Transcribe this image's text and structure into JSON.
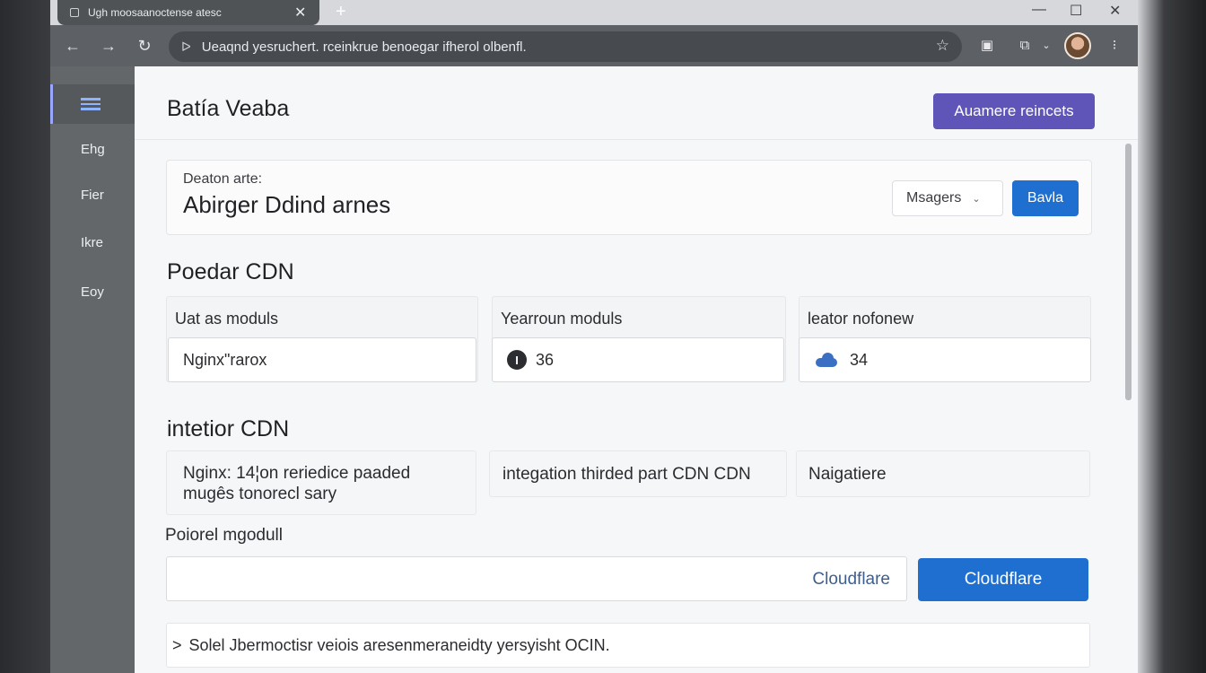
{
  "browser": {
    "tab_title": "Ugh moosaanoctense atesc",
    "tab_close": "✕",
    "new_tab": "+",
    "minimize": "—",
    "maximize": "☐",
    "close": "✕",
    "address": "Ueaqnd yesruchert. rceinkrue benoegar ifherol olbenfl.",
    "nav_back": "←",
    "nav_forward": "→",
    "nav_reload": "↻",
    "lock_icon": "ᐅ",
    "star_icon": "☆"
  },
  "sidebar": {
    "items": [
      {
        "label": "",
        "icon": "menu-icon",
        "active": true
      },
      {
        "label": "Ehg"
      },
      {
        "label": "Fier"
      },
      {
        "label": "Ikre"
      },
      {
        "label": "Eoy"
      }
    ]
  },
  "header": {
    "title": "Batía Veaba",
    "action_label": "Auamere reincets"
  },
  "summary": {
    "label": "Deaton arte:",
    "value": "Abirger Ddind arnes",
    "select_value": "Msagers",
    "button_label": "Bavla"
  },
  "section1": {
    "title": "Poedar CDN",
    "modules": [
      {
        "head": "Uat as moduls",
        "value": "Nginx\"rarox",
        "icon": ""
      },
      {
        "head": "Yearroun moduls",
        "value": "36",
        "icon": "info-icon"
      },
      {
        "head": "leator nofonew",
        "value": "34",
        "icon": "cloud-icon"
      }
    ]
  },
  "section2": {
    "title": "intetior CDN",
    "items": [
      {
        "line1": "Nginx: 14¦on reriedice paaded",
        "line2": "mugês tonorecl sary"
      },
      {
        "line1": "integation thirded part CDN CDN"
      },
      {
        "line1": "Naigatiere"
      }
    ]
  },
  "form": {
    "label": "Poiorel mgodull",
    "input_value": "",
    "input_hint": "Cloudflare",
    "button_label": "Cloudflare"
  },
  "footer": {
    "prefix": ">",
    "text": "Solel Jbermoctisr veiois aresenmeraneidty yersyisht OCIN."
  },
  "colors": {
    "primary": "#5f55b8",
    "accent_blue": "#1f6fd1",
    "sidebar_bg": "#646769",
    "toolbar_bg": "#5d6064"
  }
}
